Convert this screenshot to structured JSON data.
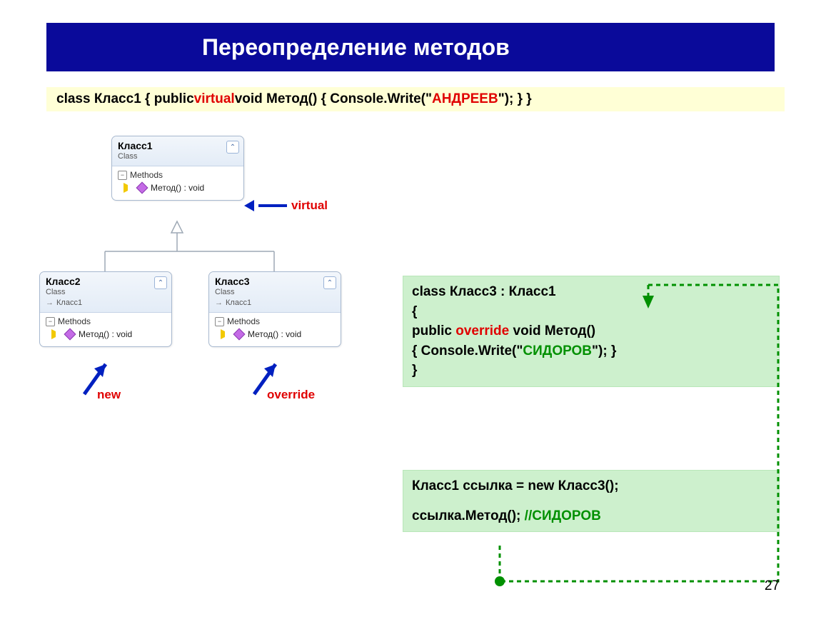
{
  "slide": {
    "title": "Переопределение методов",
    "pagenum": "27"
  },
  "codeStrip": {
    "p1": "class Класс1  {   public ",
    "virtual": "virtual",
    "p2": " void Метод() { Console.Write(\"",
    "literal": "АНДРЕЕВ",
    "p3": "\"); }   }"
  },
  "uml": {
    "class1": {
      "name": "Класс1",
      "type": "Class",
      "section": "Methods",
      "method": "Метод() : void"
    },
    "class2": {
      "name": "Класс2",
      "type": "Class",
      "inherit": "Класс1",
      "section": "Methods",
      "method": "Метод() : void"
    },
    "class3": {
      "name": "Класс3",
      "type": "Class",
      "inherit": "Класс1",
      "section": "Methods",
      "method": "Метод() : void"
    }
  },
  "annotations": {
    "virtual": "virtual",
    "newkw": "new",
    "override": "override"
  },
  "codebox1": {
    "l1a": "class Класс3 : Класс1",
    "l2a": "{",
    "l3a": "   public ",
    "l3b": "override",
    "l3c": " void Метод()",
    "l4a": "      { Console.Write(\"",
    "l4b": "СИДОРОВ",
    "l4c": "\"); }",
    "l5a": "}"
  },
  "codebox2": {
    "l1": "Класс1 ссылка = new Класс3();",
    "l2a": "ссылка.Метод();     ",
    "l2b": "//",
    "l2c": "СИДОРОВ"
  }
}
